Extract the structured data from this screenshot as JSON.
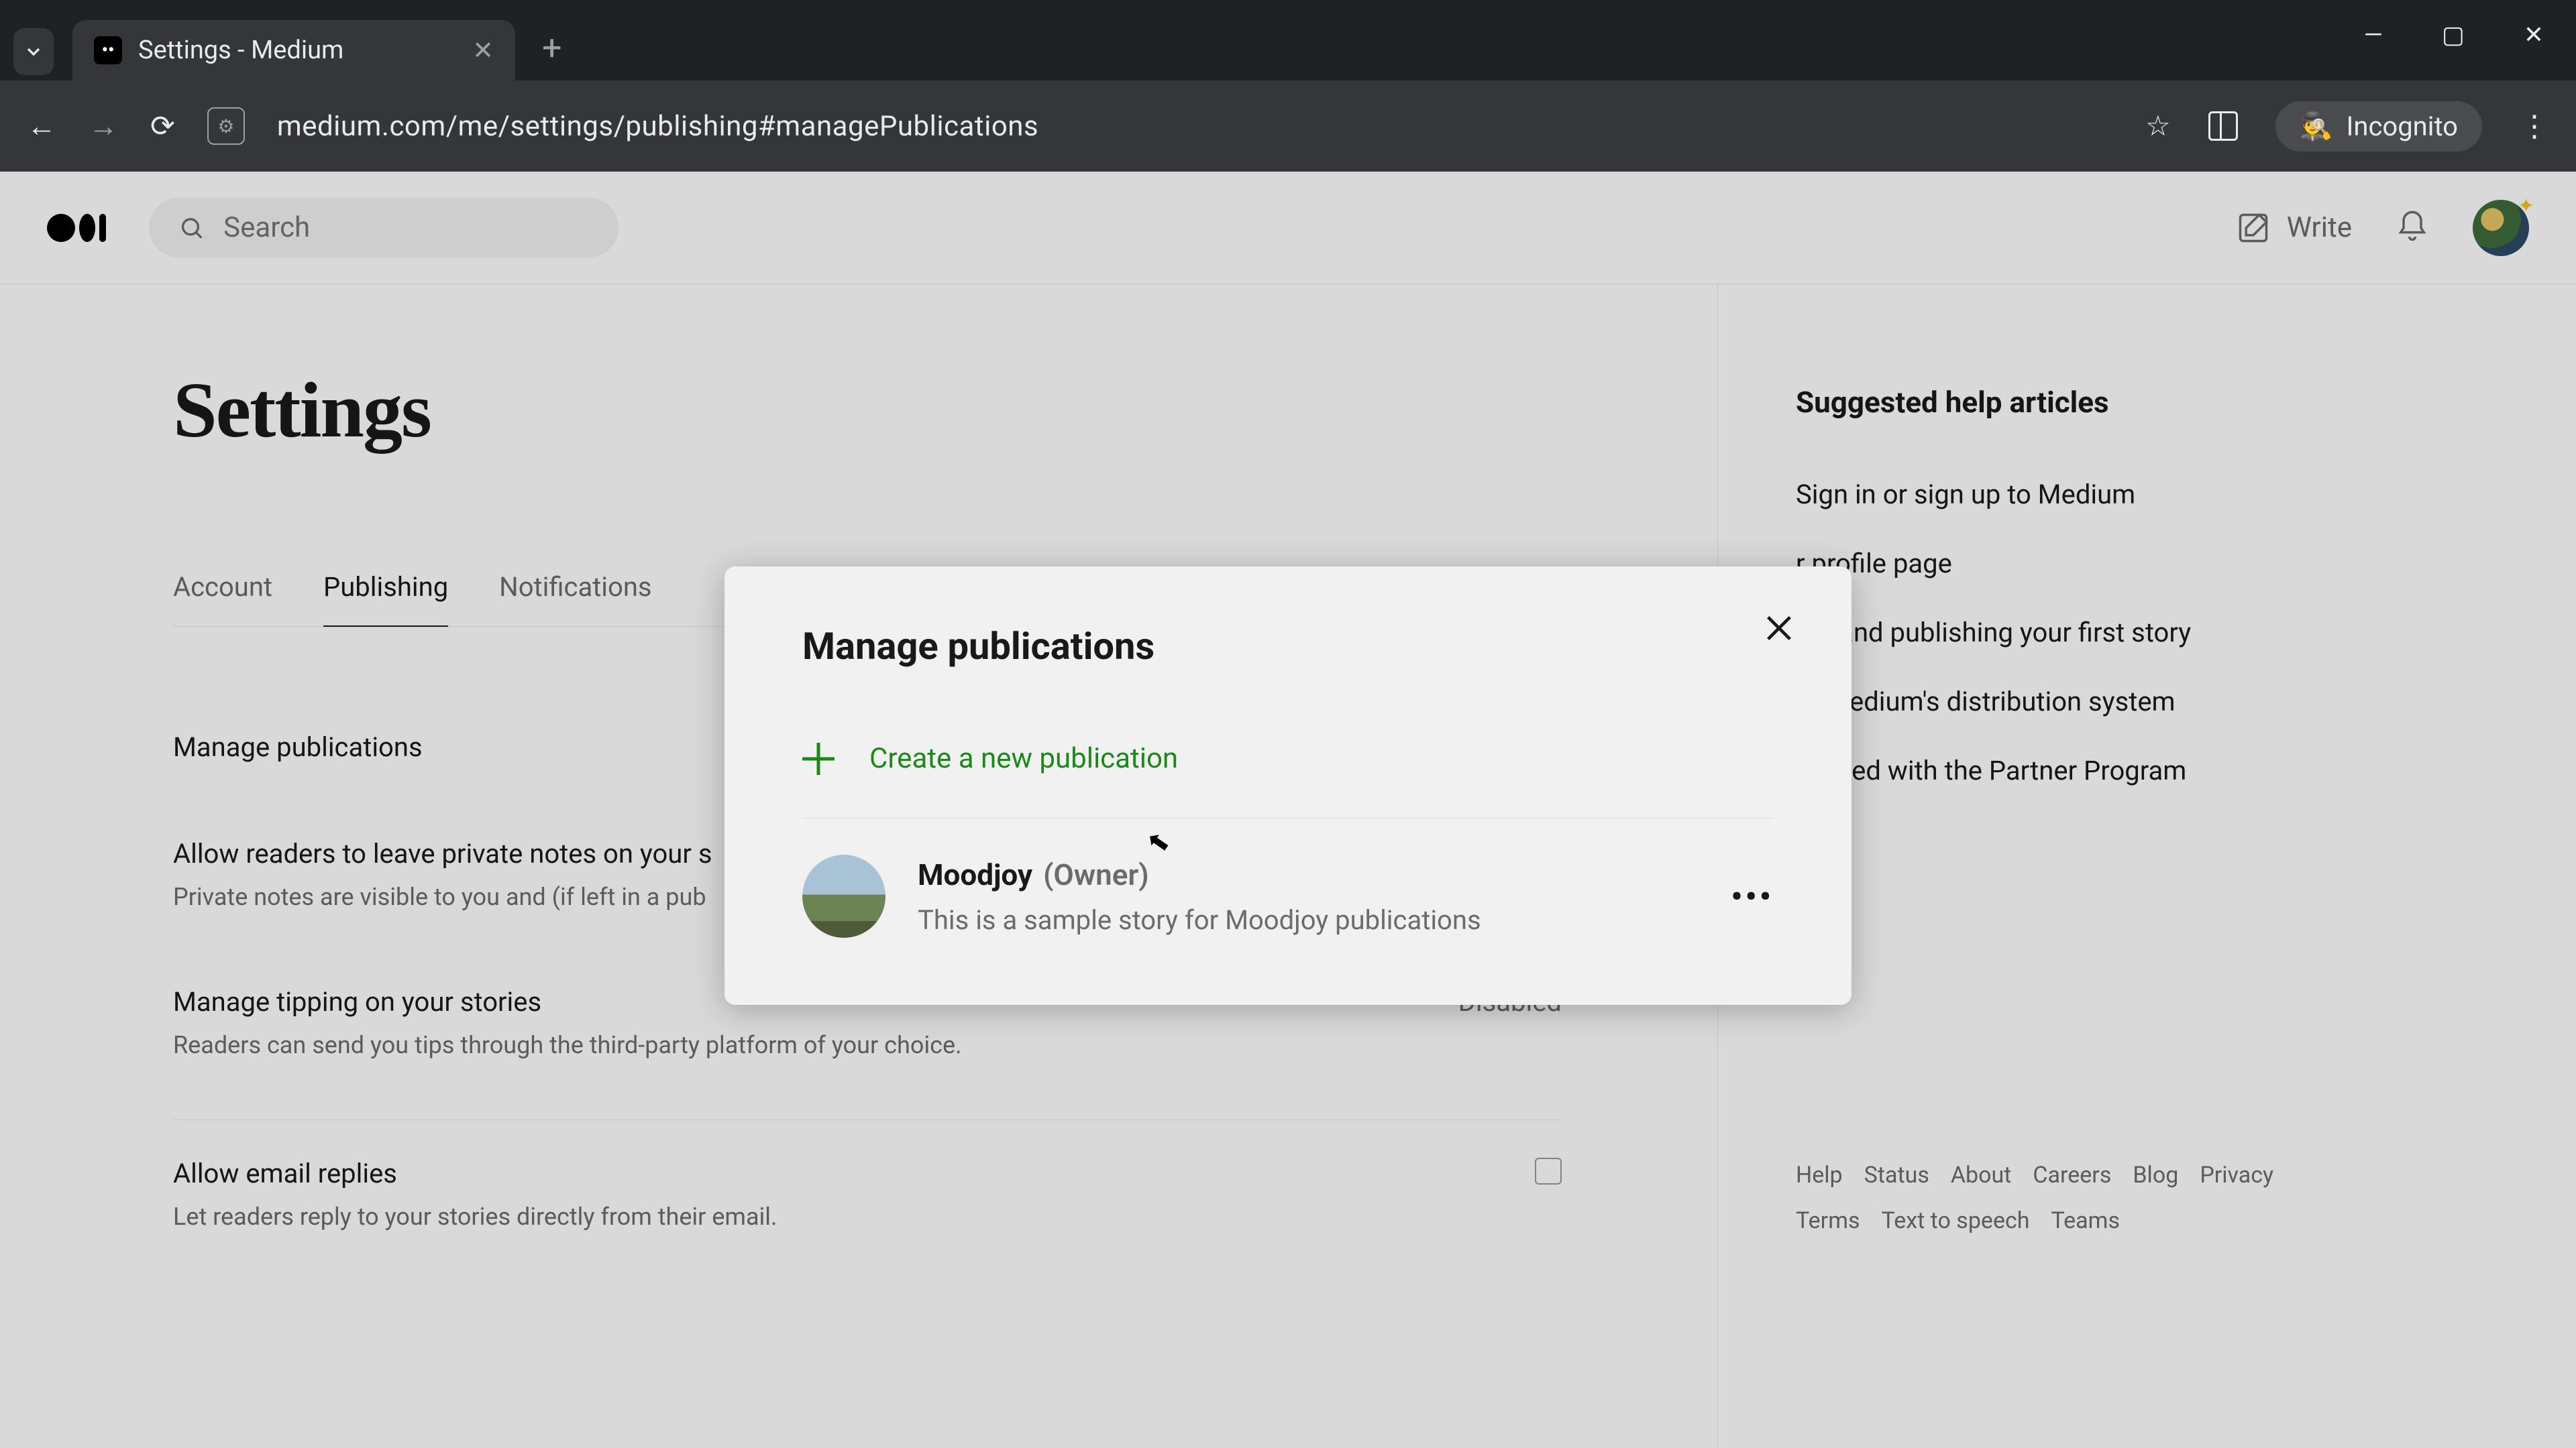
{
  "browser": {
    "tab_title": "Settings - Medium",
    "url": "medium.com/me/settings/publishing#managePublications",
    "incognito_label": "Incognito"
  },
  "topbar": {
    "search_placeholder": "Search",
    "write_label": "Write"
  },
  "page": {
    "title": "Settings",
    "tabs": [
      "Account",
      "Publishing",
      "Notifications"
    ],
    "active_tab": 1,
    "rows": {
      "manage_pubs": "Manage publications",
      "notes_title": "Allow readers to leave private notes on your s",
      "notes_sub": "Private notes are visible to you and (if left in a pub",
      "tipping_title": "Manage tipping on your stories",
      "tipping_sub": "Readers can send you tips through the third-party platform of your choice.",
      "tipping_value": "Disabled",
      "replies_title": "Allow email replies",
      "replies_sub": "Let readers reply to your stories directly from their email."
    }
  },
  "aside": {
    "heading": "Suggested help articles",
    "links": [
      "Sign in or sign up to Medium",
      "r profile page",
      "ing and publishing your first story",
      "ut Medium's distribution system",
      "started with the Partner Program"
    ],
    "footer": [
      "Help",
      "Status",
      "About",
      "Careers",
      "Blog",
      "Privacy",
      "Terms",
      "Text to speech",
      "Teams"
    ]
  },
  "modal": {
    "title": "Manage publications",
    "create_label": "Create a new publication",
    "publication": {
      "name": "Moodjoy",
      "role": "(Owner)",
      "desc": "This is a sample story for Moodjoy publications"
    }
  }
}
